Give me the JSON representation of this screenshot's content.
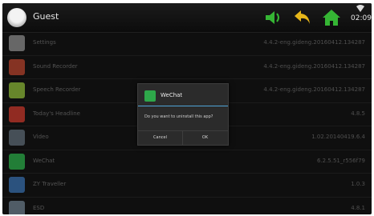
{
  "header": {
    "user_name": "Guest",
    "time": "02:09"
  },
  "apps": [
    {
      "name": "Settings",
      "version": "4.4.2-eng.gideng.20160412.134287",
      "icon": "gear-icon",
      "color": "#8a8a8a"
    },
    {
      "name": "Sound Recorder",
      "version": "4.4.2-eng.gideng.20160412.134287",
      "icon": "sound-recorder-icon",
      "color": "#b2452f"
    },
    {
      "name": "Speech Recorder",
      "version": "4.4.2-eng.gideng.20160412.134287",
      "icon": "android-icon",
      "color": "#8ab33a"
    },
    {
      "name": "Today's Headline",
      "version": "4.8.5",
      "icon": "news-icon",
      "color": "#c23a2e"
    },
    {
      "name": "Video",
      "version": "1.02.20140419.6.4",
      "icon": "video-icon",
      "color": "#5e6a74"
    },
    {
      "name": "WeChat",
      "version": "6.2.5.51_r556f79",
      "icon": "wechat-icon",
      "color": "#2ea84a"
    },
    {
      "name": "ZY Traveller",
      "version": "1.0.3",
      "icon": "traveller-icon",
      "color": "#3a6ea8"
    },
    {
      "name": "ESD",
      "version": "4.8.1",
      "icon": "es-file-icon",
      "color": "#6b7b88"
    }
  ],
  "dialog": {
    "title": "WeChat",
    "message": "Do you want to uninstall this app?",
    "cancel_label": "Cancel",
    "ok_label": "OK"
  },
  "colors": {
    "accent_green": "#35b534",
    "back_arrow": "#e6b61a",
    "dialog_divider": "#4fa3d8"
  }
}
